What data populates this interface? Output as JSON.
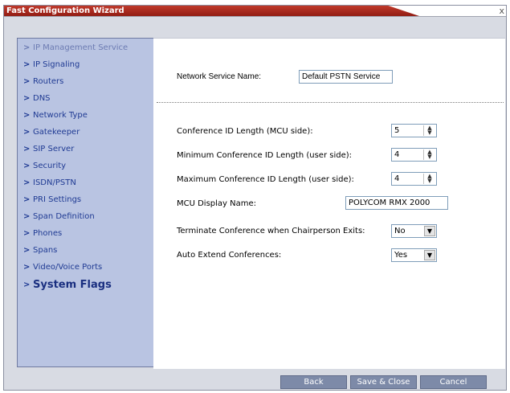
{
  "window": {
    "title": "Fast Configuration Wizard",
    "close_glyph": "x"
  },
  "sidebar": {
    "items": [
      {
        "label": "IP Management Service",
        "state": "dim"
      },
      {
        "label": "IP Signaling",
        "state": "normal"
      },
      {
        "label": "Routers",
        "state": "normal"
      },
      {
        "label": "DNS",
        "state": "normal"
      },
      {
        "label": "Network Type",
        "state": "normal"
      },
      {
        "label": "Gatekeeper",
        "state": "normal"
      },
      {
        "label": "SIP Server",
        "state": "normal"
      },
      {
        "label": "Security",
        "state": "normal"
      },
      {
        "label": "ISDN/PSTN",
        "state": "normal"
      },
      {
        "label": "PRI Settings",
        "state": "normal"
      },
      {
        "label": "Span Definition",
        "state": "normal"
      },
      {
        "label": "Phones",
        "state": "normal"
      },
      {
        "label": "Spans",
        "state": "normal"
      },
      {
        "label": "Video/Voice Ports",
        "state": "normal"
      },
      {
        "label": "System Flags",
        "state": "current"
      }
    ],
    "chevron_icon": "chevron-right-icon"
  },
  "form": {
    "network_service_name_label": "Network Service Name:",
    "network_service_name_value": "Default PSTN Service",
    "conf_id_length_label": "Conference ID Length (MCU side):",
    "conf_id_length_value": "5",
    "min_conf_id_length_label": "Minimum Conference ID Length (user side):",
    "min_conf_id_length_value": "4",
    "max_conf_id_length_label": "Maximum Conference ID Length (user side):",
    "max_conf_id_length_value": "4",
    "mcu_display_name_label": "MCU Display Name:",
    "mcu_display_name_value": "POLYCOM RMX 2000",
    "terminate_label": "Terminate Conference when Chairperson Exits:",
    "terminate_value": "No",
    "auto_extend_label": "Auto Extend Conferences:",
    "auto_extend_value": "Yes"
  },
  "footer": {
    "back_label": "Back",
    "save_close_label": "Save & Close",
    "cancel_label": "Cancel"
  },
  "colors": {
    "title_bar": "#b32b1e",
    "sidebar_bg": "#b9c4e2",
    "nav_text": "#1f3a93",
    "button_bg": "#7d8aa8"
  }
}
